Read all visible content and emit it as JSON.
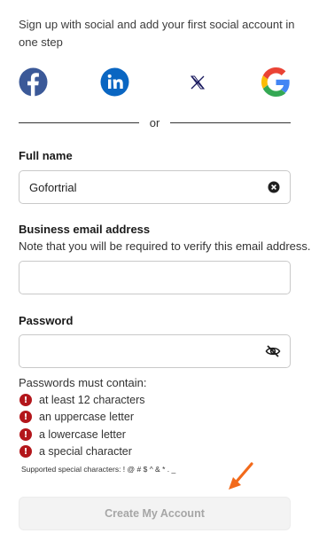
{
  "intro": {
    "text": "Sign up with social and add your first social account in one step"
  },
  "social": [
    {
      "name": "facebook",
      "icon": "facebook-icon",
      "color": "#3b5998"
    },
    {
      "name": "linkedin",
      "icon": "linkedin-icon",
      "color": "#0a66c2"
    },
    {
      "name": "x",
      "icon": "x-icon",
      "color": "#1a1a5e"
    },
    {
      "name": "google",
      "icon": "google-icon"
    }
  ],
  "divider": {
    "text": "or"
  },
  "full_name": {
    "label": "Full name",
    "value": "Gofortrial",
    "clear_icon": "clear-icon"
  },
  "email": {
    "label": "Business email address",
    "note": "Note that you will be required to verify this email address.",
    "value": ""
  },
  "password": {
    "label": "Password",
    "value": "",
    "toggle_icon": "eye-off-icon"
  },
  "requirements": {
    "title": "Passwords must contain:",
    "items": [
      "at least 12 characters",
      "an uppercase letter",
      "a lowercase letter",
      "a special character"
    ],
    "error_symbol": "!",
    "error_color": "#b3161b",
    "special_note": "Supported special characters: ! @ # $ ^ & * . _"
  },
  "submit": {
    "label": "Create My Account",
    "disabled": true
  },
  "accent_color": "#f26a1b"
}
